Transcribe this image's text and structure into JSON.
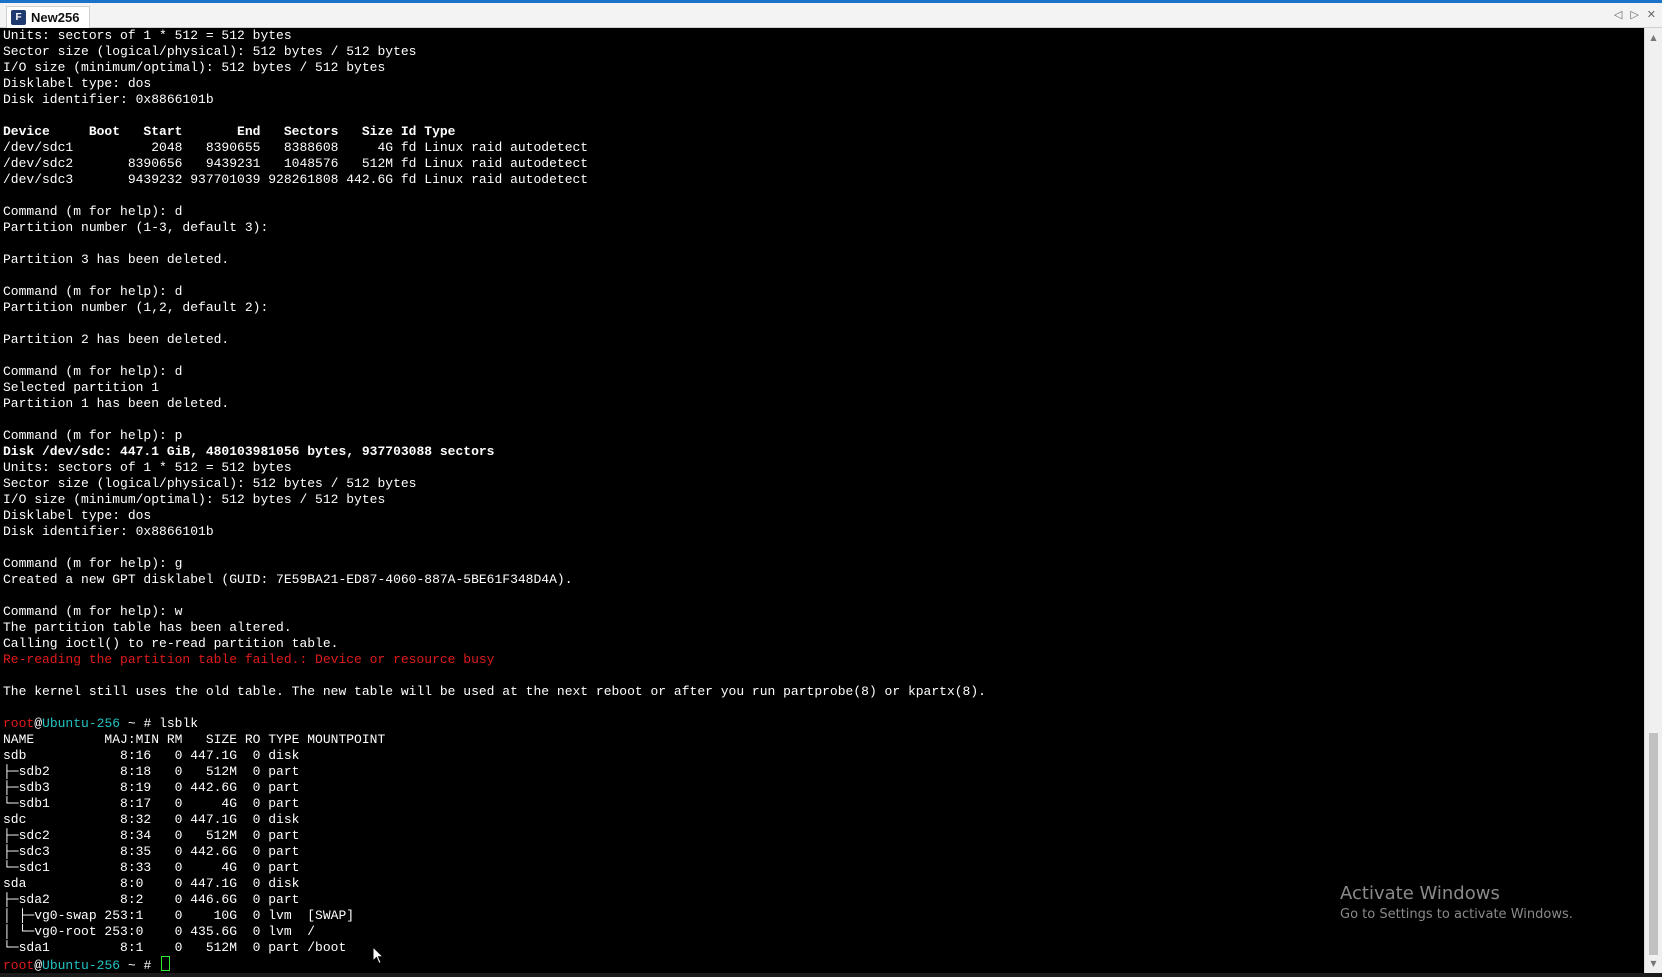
{
  "tab": {
    "icon_text": "F",
    "title": "New256"
  },
  "controls": {
    "prev": "◁",
    "next": "▷",
    "close": "✕"
  },
  "terminal": {
    "lines": [
      {
        "t": "Units: sectors of 1 * 512 = 512 bytes"
      },
      {
        "t": "Sector size (logical/physical): 512 bytes / 512 bytes"
      },
      {
        "t": "I/O size (minimum/optimal): 512 bytes / 512 bytes"
      },
      {
        "t": "Disklabel type: dos"
      },
      {
        "t": "Disk identifier: 0x8866101b"
      },
      {
        "t": ""
      },
      {
        "t": "Device     Boot   Start       End   Sectors   Size Id Type",
        "s": "bold"
      },
      {
        "t": "/dev/sdc1          2048   8390655   8388608     4G fd Linux raid autodetect"
      },
      {
        "t": "/dev/sdc2       8390656   9439231   1048576   512M fd Linux raid autodetect"
      },
      {
        "t": "/dev/sdc3       9439232 937701039 928261808 442.6G fd Linux raid autodetect"
      },
      {
        "t": ""
      },
      {
        "t": "Command (m for help): d"
      },
      {
        "t": "Partition number (1-3, default 3):"
      },
      {
        "t": ""
      },
      {
        "t": "Partition 3 has been deleted."
      },
      {
        "t": ""
      },
      {
        "t": "Command (m for help): d"
      },
      {
        "t": "Partition number (1,2, default 2):"
      },
      {
        "t": ""
      },
      {
        "t": "Partition 2 has been deleted."
      },
      {
        "t": ""
      },
      {
        "t": "Command (m for help): d"
      },
      {
        "t": "Selected partition 1"
      },
      {
        "t": "Partition 1 has been deleted."
      },
      {
        "t": ""
      },
      {
        "t": "Command (m for help): p"
      },
      {
        "t": "Disk /dev/sdc: 447.1 GiB, 480103981056 bytes, 937703088 sectors",
        "s": "bold"
      },
      {
        "t": "Units: sectors of 1 * 512 = 512 bytes"
      },
      {
        "t": "Sector size (logical/physical): 512 bytes / 512 bytes"
      },
      {
        "t": "I/O size (minimum/optimal): 512 bytes / 512 bytes"
      },
      {
        "t": "Disklabel type: dos"
      },
      {
        "t": "Disk identifier: 0x8866101b"
      },
      {
        "t": ""
      },
      {
        "t": "Command (m for help): g"
      },
      {
        "t": "Created a new GPT disklabel (GUID: 7E59BA21-ED87-4060-887A-5BE61F348D4A)."
      },
      {
        "t": ""
      },
      {
        "t": "Command (m for help): w"
      },
      {
        "t": "The partition table has been altered."
      },
      {
        "t": "Calling ioctl() to re-read partition table."
      },
      {
        "t": "Re-reading the partition table failed.: Device or resource busy",
        "s": "err"
      },
      {
        "t": ""
      },
      {
        "t": "The kernel still uses the old table. The new table will be used at the next reboot or after you run partprobe(8) or kpartx(8)."
      },
      {
        "t": ""
      },
      {
        "prompt": {
          "user": "root",
          "at": "@",
          "host": "Ubuntu-256",
          "path": " ~ # ",
          "cmd": "lsblk"
        }
      },
      {
        "t": "NAME         MAJ:MIN RM   SIZE RO TYPE MOUNTPOINT"
      },
      {
        "t": "sdb            8:16   0 447.1G  0 disk"
      },
      {
        "t": "├─sdb2         8:18   0   512M  0 part"
      },
      {
        "t": "├─sdb3         8:19   0 442.6G  0 part"
      },
      {
        "t": "└─sdb1         8:17   0     4G  0 part"
      },
      {
        "t": "sdc            8:32   0 447.1G  0 disk"
      },
      {
        "t": "├─sdc2         8:34   0   512M  0 part"
      },
      {
        "t": "├─sdc3         8:35   0 442.6G  0 part"
      },
      {
        "t": "└─sdc1         8:33   0     4G  0 part"
      },
      {
        "t": "sda            8:0    0 447.1G  0 disk"
      },
      {
        "t": "├─sda2         8:2    0 446.6G  0 part"
      },
      {
        "t": "│ ├─vg0-swap 253:1    0    10G  0 lvm  [SWAP]"
      },
      {
        "t": "│ └─vg0-root 253:0    0 435.6G  0 lvm  /"
      },
      {
        "t": "└─sda1         8:1    0   512M  0 part /boot"
      },
      {
        "prompt": {
          "user": "root",
          "at": "@",
          "host": "Ubuntu-256",
          "path": " ~ # ",
          "cmd": ""
        },
        "cursor": true
      }
    ]
  },
  "scrollbar": {
    "up": "▲",
    "down": "▼"
  },
  "watermark": {
    "title": "Activate Windows",
    "subtitle": "Go to Settings to activate Windows."
  }
}
